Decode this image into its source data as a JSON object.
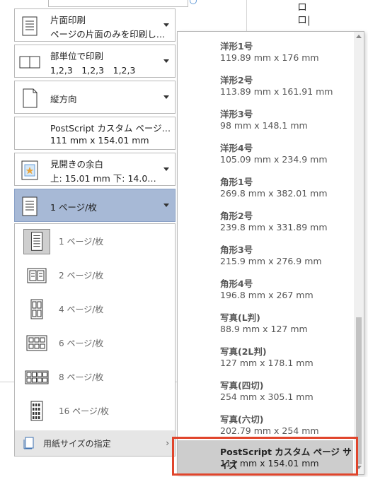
{
  "document": {
    "glyphs": "ロロ|"
  },
  "settings": [
    {
      "line1": "片面印刷",
      "line2": "ページの片面のみを印刷し…",
      "icon": "single-sided-icon"
    },
    {
      "line1": "部単位で印刷",
      "line2": "1,2,3　1,2,3　1,2,3",
      "icon": "collated-icon"
    },
    {
      "line1": "縦方向",
      "line2": "",
      "icon": "portrait-orientation-icon"
    },
    {
      "line1": "PostScript カスタム ページ…",
      "line2": "111 mm x 154.01 mm",
      "icon": ""
    },
    {
      "line1": "見開きの余白",
      "line2": "上: 15.01 mm 下: 14.0…",
      "icon": "margins-icon"
    },
    {
      "line1": "1 ページ/枚",
      "line2": "",
      "icon": "pages-per-sheet-icon"
    }
  ],
  "pages_per_sheet": {
    "selected": "1 ページ/枚",
    "options": [
      {
        "label": "1 ページ/枚",
        "icon": "one-page-icon"
      },
      {
        "label": "2 ページ/枚",
        "icon": "two-pages-icon"
      },
      {
        "label": "4 ページ/枚",
        "icon": "four-pages-icon"
      },
      {
        "label": "6 ページ/枚",
        "icon": "six-pages-icon"
      },
      {
        "label": "8 ページ/枚",
        "icon": "eight-pages-icon"
      },
      {
        "label": "16 ページ/枚",
        "icon": "sixteen-pages-icon"
      }
    ],
    "paper_size_label": "用紙サイズの指定"
  },
  "paper_sizes": [
    {
      "name": "洋形1号",
      "dims": "119.89 mm x 176 mm"
    },
    {
      "name": "洋形2号",
      "dims": "113.89 mm x 161.91 mm"
    },
    {
      "name": "洋形3号",
      "dims": "98 mm x 148.1 mm"
    },
    {
      "name": "洋形4号",
      "dims": "105.09 mm x 234.9 mm"
    },
    {
      "name": "角形1号",
      "dims": "269.8 mm x 382.01 mm"
    },
    {
      "name": "角形2号",
      "dims": "239.8 mm x 331.89 mm"
    },
    {
      "name": "角形3号",
      "dims": "215.9 mm x 276.9 mm"
    },
    {
      "name": "角形4号",
      "dims": "196.8 mm x 267 mm"
    },
    {
      "name": "写真(L判)",
      "dims": "88.9 mm x 127 mm"
    },
    {
      "name": "写真(2L判)",
      "dims": "127 mm x 178.1 mm"
    },
    {
      "name": "写真(四切)",
      "dims": "254 mm x 305.1 mm"
    },
    {
      "name": "写真(六切)",
      "dims": "202.79 mm x 254 mm"
    },
    {
      "name": "PostScript カスタム ページ サイズ",
      "dims": "111 mm x 154.01 mm"
    }
  ],
  "colors": {
    "selected_setting": "#a7b9d6",
    "highlight": "#cdcdcd",
    "annotation_box": "#e0452c"
  }
}
